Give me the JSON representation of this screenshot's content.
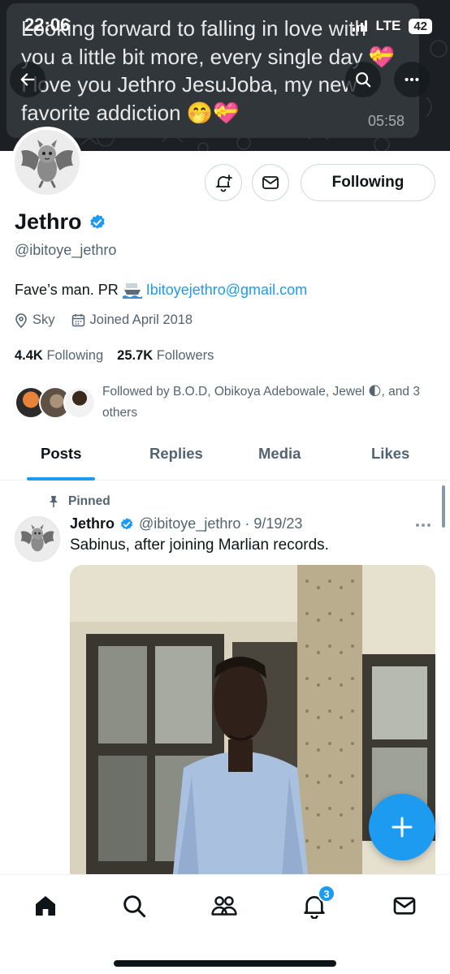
{
  "status_bar": {
    "time": "22:06",
    "network": "LTE",
    "battery": "42"
  },
  "banner": {
    "message": "Looking forward to falling in love with you a little bit more, every single day 💝 I love you Jethro JesuJoba, my new favorite addiction 🤭💝",
    "message_time": "05:58"
  },
  "profile": {
    "name": "Jethro",
    "handle": "@ibitoye_jethro",
    "bio_prefix": "Fave’s man. PR",
    "bio_link": "Ibitoyejethro@gmail.com",
    "location": "Sky",
    "joined": "Joined April 2018",
    "following_count": "4.4K",
    "following_label": "Following",
    "followers_count": "25.7K",
    "followers_label": "Followers",
    "followed_by": "Followed by B.O.D, Obikoya Adebowale, Jewel 🌓, and 3 others",
    "following_button": "Following"
  },
  "tabs": [
    "Posts",
    "Replies",
    "Media",
    "Likes"
  ],
  "active_tab": "Posts",
  "post": {
    "pinned_label": "Pinned",
    "author": "Jethro",
    "handle_date": "@ibitoye_jethro · 9/19/23",
    "text": "Sabinus, after joining Marlian records."
  },
  "nav": {
    "notifications_badge": "3"
  },
  "colors": {
    "accent": "#1d9bf0",
    "text_primary": "#0f1419",
    "text_secondary": "#536471"
  },
  "icons": [
    "back-arrow-icon",
    "search-icon",
    "more-icon",
    "bat-avatar-icon",
    "notification-add-icon",
    "mail-icon",
    "verified-icon",
    "location-icon",
    "calendar-icon",
    "pin-icon",
    "plus-icon",
    "home-icon",
    "communities-icon",
    "bell-icon"
  ]
}
